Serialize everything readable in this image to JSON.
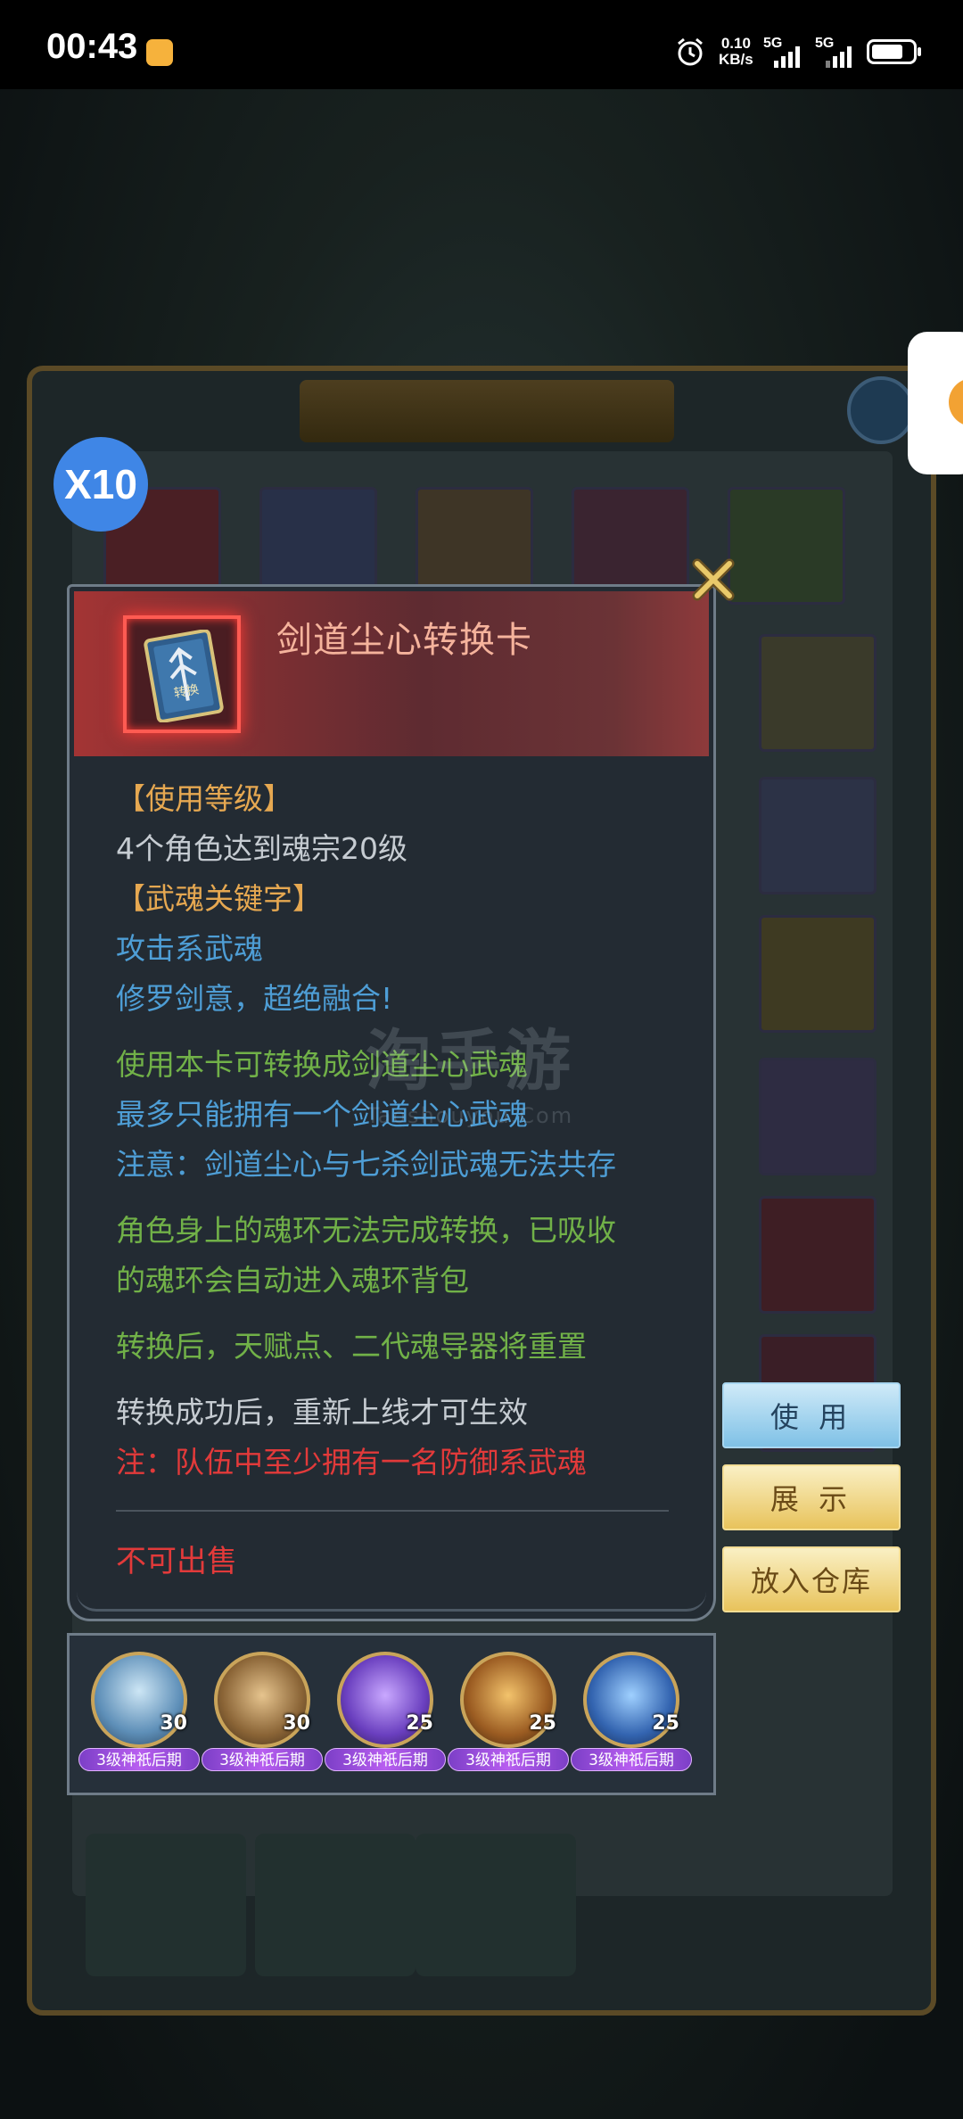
{
  "status_bar": {
    "time": "00:43",
    "net_speed_value": "0.10",
    "net_speed_unit": "KB/s",
    "signal_1_label": "5G",
    "signal_2_label": "5G"
  },
  "background": {
    "badge": "X10"
  },
  "item": {
    "name": "剑道尘心转换卡",
    "card_text": "转换"
  },
  "description": {
    "use_level_heading": "【使用等级】",
    "use_level_text": "4个角色达到魂宗20级",
    "keyword_heading": "【武魂关键字】",
    "keyword_1": "攻击系武魂",
    "keyword_2": "修罗剑意，超绝融合!",
    "effect_1": "使用本卡可转换成剑道尘心武魂",
    "effect_2": "最多只能拥有一个剑道尘心武魂",
    "effect_3": "注意：剑道尘心与七杀剑武魂无法共存",
    "ring_1": "角色身上的魂环无法完成转换，已吸收",
    "ring_2": "的魂环会自动进入魂环背包",
    "reset": "转换后，天赋点、二代魂导器将重置",
    "relogin": "转换成功后，重新上线才可生效",
    "team_note": "注：队伍中至少拥有一名防御系武魂",
    "not_sellable": "不可出售"
  },
  "watermark": {
    "cn": "淘手游",
    "en": "Taoshouyou.Com"
  },
  "actions": {
    "use": "使 用",
    "show": "展 示",
    "store": "放入仓库"
  },
  "characters": [
    {
      "level": "30",
      "tag": "3级神祇后期"
    },
    {
      "level": "30",
      "tag": "3级神祇后期"
    },
    {
      "level": "25",
      "tag": "3级神祇后期"
    },
    {
      "level": "25",
      "tag": "3级神祇后期"
    },
    {
      "level": "25",
      "tag": "3级神祇后期"
    }
  ],
  "colors": {
    "item_name": "#f5b39c",
    "heading": "#e6a851",
    "normal": "#c6ccd2",
    "keyword": "#4e9ed6",
    "effect_green": "#71b148",
    "warning_red": "#e23a3a",
    "tag_purple": "#b85ef0"
  }
}
